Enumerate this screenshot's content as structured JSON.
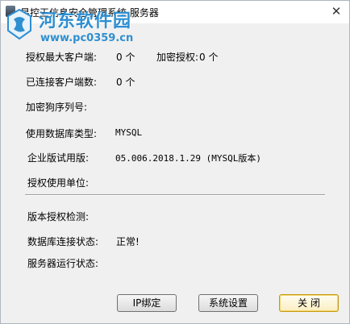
{
  "window": {
    "title": "易控王信息安全管理系统 服务器",
    "close_glyph": "✕"
  },
  "watermark": {
    "name": "河东软件园",
    "url": "www.pc0359.cn"
  },
  "info": {
    "max_clients_label": "授权最大客户端:",
    "max_clients_value": "0 个",
    "encrypted_auth_label": "加密授权:",
    "encrypted_auth_value": "0 个",
    "connected_label": "已连接客户端数:",
    "connected_value": "0 个",
    "dongle_serial_label": "加密狗序列号:",
    "db_type_label": "使用数据库类型:",
    "db_type_value": "MYSQL",
    "edition_label": "企业版试用版:",
    "edition_value": "05.006.2018.1.29 (MYSQL版本)",
    "licensee_label": "授权使用单位:"
  },
  "status": {
    "license_check_label": "版本授权检测:",
    "db_conn_label": "数据库连接状态:",
    "db_conn_value": "正常!",
    "server_run_label": "服务器运行状态:"
  },
  "buttons": {
    "ip_bind": "IP绑定",
    "system_settings": "系统设置",
    "close": "关 闭"
  }
}
